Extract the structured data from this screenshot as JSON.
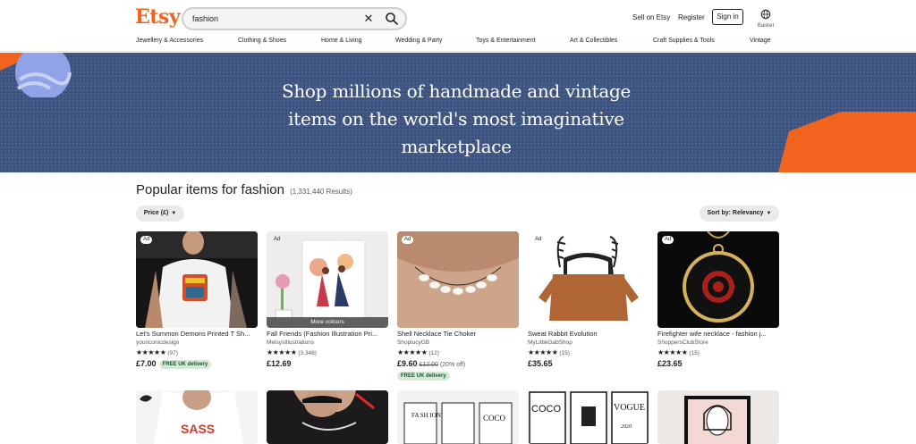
{
  "header": {
    "logo": "Etsy",
    "search_value": "fashion",
    "sell": "Sell on Etsy",
    "register": "Register",
    "signin": "Sign in",
    "basket": "Basket"
  },
  "categories": [
    "Jewellery & Accessories",
    "Clothing & Shoes",
    "Home & Living",
    "Wedding & Party",
    "Toys & Entertainment",
    "Art & Collectibles",
    "Craft Supplies & Tools",
    "Vintage"
  ],
  "hero": {
    "line1": "Shop millions of handmade and vintage",
    "line2": "items on the world's most imaginative",
    "line3": "marketplace"
  },
  "results": {
    "title": "Popular items for fashion",
    "count": "(1,331,440 Results)",
    "price_filter": "Price (£)",
    "sort": "Sort by: Relevancy"
  },
  "products": [
    {
      "ad": "Ad",
      "title": "Let's Summon Demons Printed T Sh...",
      "shop": "youriconicdesign",
      "stars": "★★★★★",
      "reviews": "(97)",
      "price": "£7.00",
      "badge": "FREE UK delivery"
    },
    {
      "ad": "Ad",
      "title": "Fall Friends (Fashion Illustration Pri...",
      "shop": "MelsysIllustrations",
      "stars": "★★★★★",
      "reviews": "(3,348)",
      "price": "£12.69",
      "overlay": "More colours"
    },
    {
      "ad": "Ad",
      "title": "Shell Necklace Tie Choker",
      "shop": "ShoplucyGB",
      "stars": "★★★★★",
      "reviews": "(12)",
      "price": "£9.60",
      "orig": "£12.00",
      "disc": "(20% off)",
      "badge": "FREE UK delivery"
    },
    {
      "ad": "Ad",
      "title": "Sweat Rabbit Evolution",
      "shop": "MyLittleGabShop",
      "stars": "★★★★★",
      "reviews": "(15)",
      "price": "£35.65"
    },
    {
      "ad": "Ad",
      "title": "Firefighter wife necklace - fashion j...",
      "shop": "ShoppersClubStore",
      "stars": "★★★★★",
      "reviews": "(15)",
      "price": "£23.65"
    }
  ],
  "row2_text": {
    "p2": "SASS",
    "p3a": "FA SH ION",
    "p3b": "COCO",
    "p4a": "COCO",
    "p4b": "VOGUE",
    "p4c": "2020"
  },
  "colors": {
    "brand": "#f1641e",
    "hero_bg": "#3e5583",
    "badge_bg": "#d4e9d7"
  }
}
